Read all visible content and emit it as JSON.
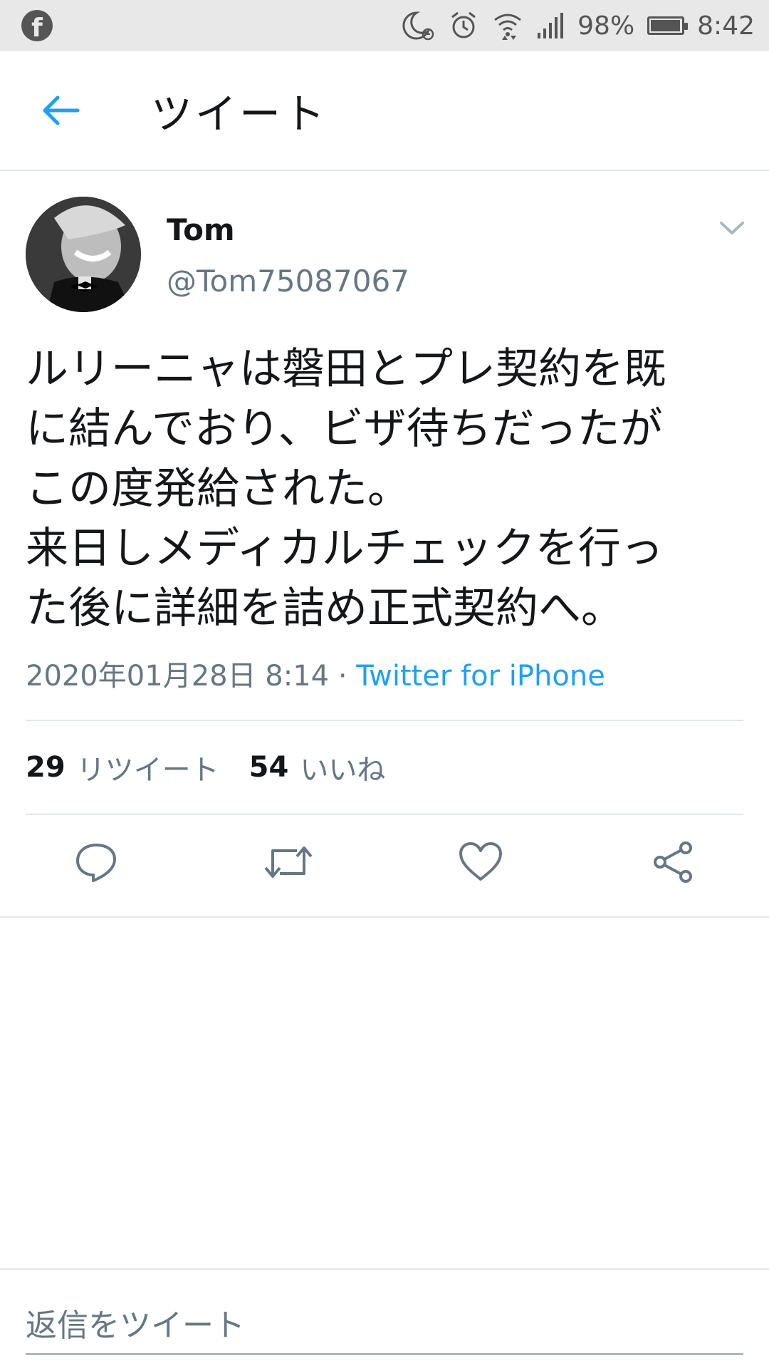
{
  "status_bar": {
    "battery": "98%",
    "time": "8:42",
    "battery_level": 0.98,
    "icons": [
      "facebook-icon",
      "moon-alarm-icon",
      "alarm-icon",
      "wifi-icon",
      "signal-icon",
      "battery-icon"
    ]
  },
  "header": {
    "title": "ツイート",
    "back_icon": "arrow-left-icon"
  },
  "tweet": {
    "author_name": "Tom",
    "author_handle": "@Tom75087067",
    "text": "ルリーニャは磐田とプレ契約を既\nに結んでおり、ビザ待ちだったが\nこの度発給された。\n来日しメディカルチェックを行っ\nた後に詳細を詰め正式契約へ。",
    "timestamp": "2020年01月28日 8:14",
    "separator": "·",
    "source": "Twitter for iPhone",
    "retweets_count": "29",
    "retweets_label": "リツイート",
    "likes_count": "54",
    "likes_label": "いいね"
  },
  "actions": [
    "reply-icon",
    "retweet-icon",
    "like-icon",
    "share-icon"
  ],
  "reply": {
    "placeholder": "返信をツイート"
  },
  "colors": {
    "accent": "#1da1f2",
    "secondary_text": "#657786",
    "primary_text": "#14171a",
    "divider": "#e1e8ed"
  }
}
